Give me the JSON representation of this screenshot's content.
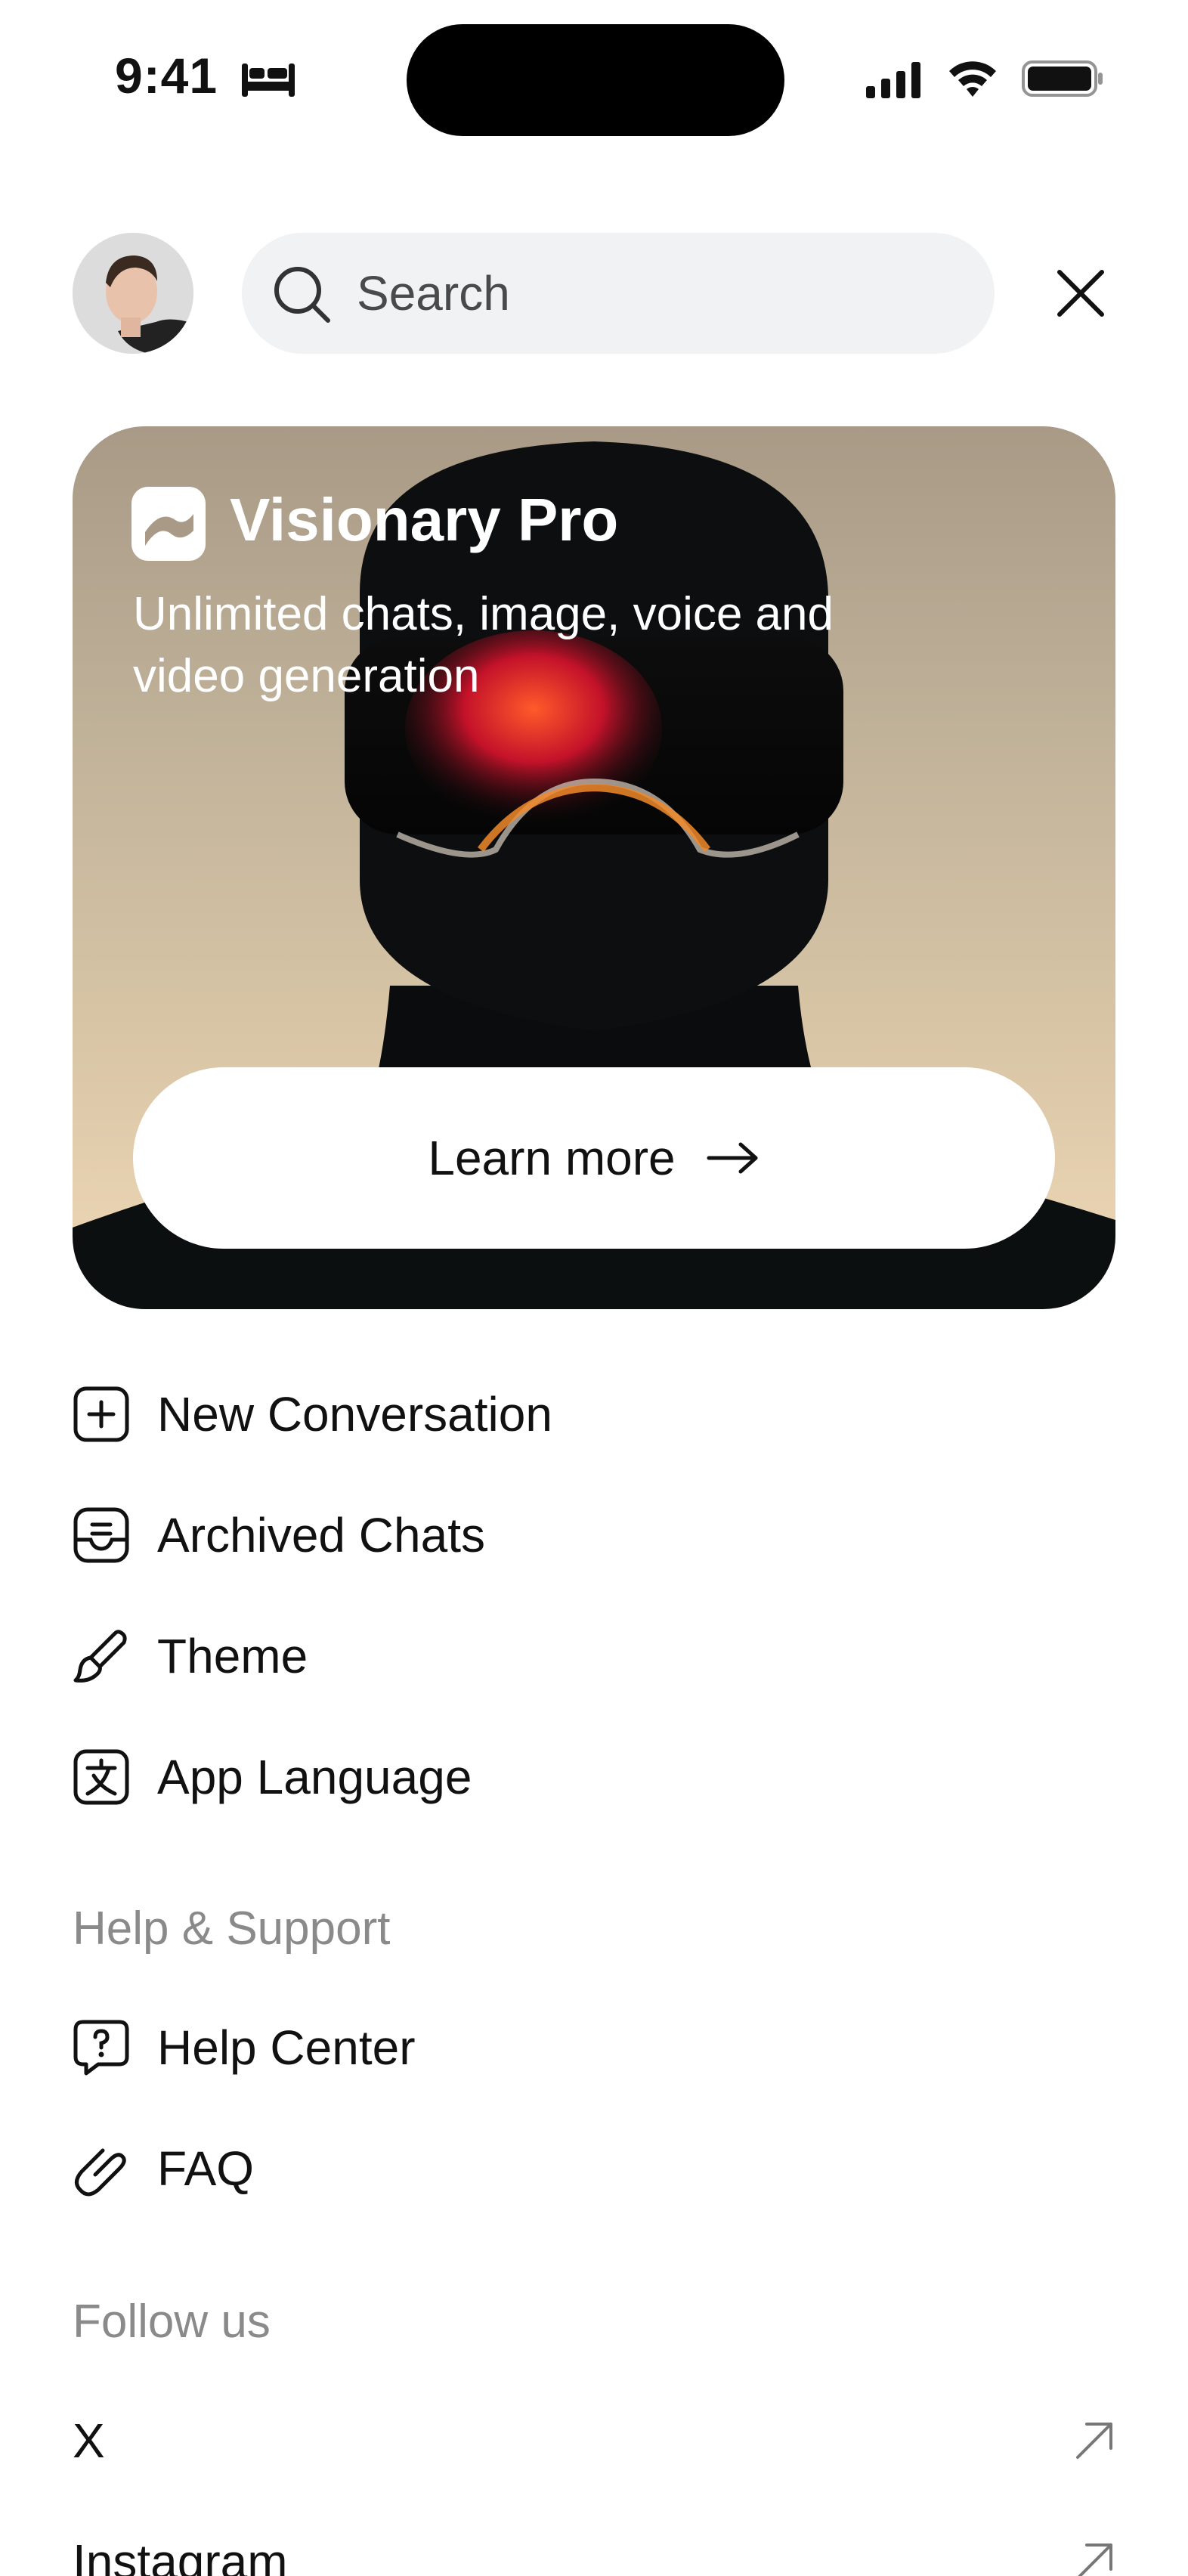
{
  "status_bar": {
    "time": "9:41"
  },
  "search": {
    "placeholder": "Search"
  },
  "promo": {
    "title": "Visionary Pro",
    "subtitle": "Unlimited chats, image, voice and video generation",
    "cta_label": "Learn more"
  },
  "menu": {
    "items": [
      {
        "label": "New Conversation",
        "icon": "plus-square-icon"
      },
      {
        "label": "Archived Chats",
        "icon": "archive-icon"
      },
      {
        "label": "Theme",
        "icon": "brush-icon"
      },
      {
        "label": "App Language",
        "icon": "language-icon"
      }
    ]
  },
  "help": {
    "title": "Help & Support",
    "items": [
      {
        "label": "Help Center",
        "icon": "help-bubble-icon"
      },
      {
        "label": "FAQ",
        "icon": "faq-icon"
      }
    ]
  },
  "follow": {
    "title": "Follow us",
    "items": [
      {
        "label": "X",
        "icon": "external-arrow-icon"
      },
      {
        "label": "Instagram",
        "icon": "external-arrow-icon"
      }
    ]
  },
  "colors": {
    "promo_gradient_top": "#a89a86",
    "promo_gradient_bottom": "#efd8b7",
    "accent_glow": "#e0452a",
    "section_gray": "#8a8a8a"
  }
}
